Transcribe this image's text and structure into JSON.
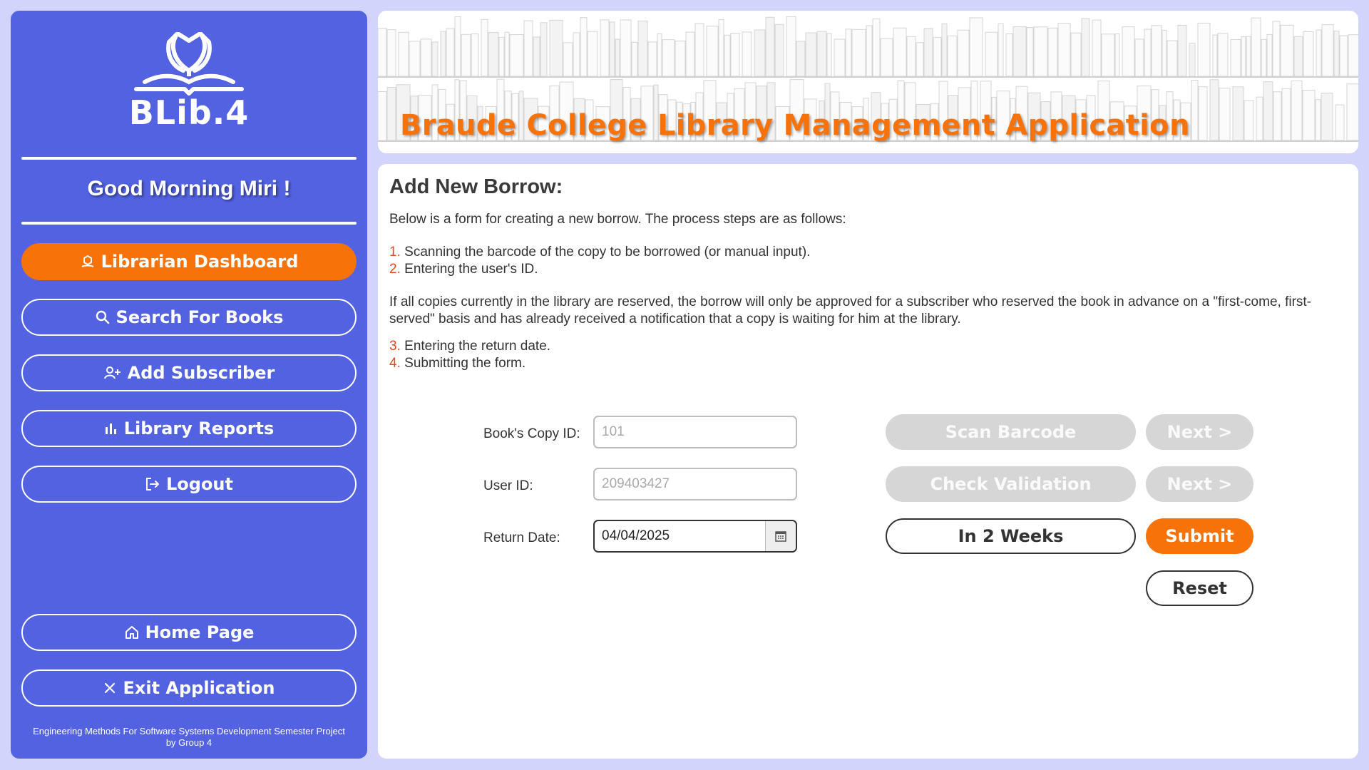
{
  "app": {
    "logo_text": "BLib.4",
    "banner_title": "Braude College Library Management Application"
  },
  "sidebar": {
    "greeting": "Good Morning Miri !",
    "items": [
      {
        "label": "Librarian Dashboard",
        "icon": "dashboard-icon",
        "active": true
      },
      {
        "label": "Search For Books",
        "icon": "search-icon"
      },
      {
        "label": "Add Subscriber",
        "icon": "add-user-icon"
      },
      {
        "label": "Library Reports",
        "icon": "bar-chart-icon"
      },
      {
        "label": "Logout",
        "icon": "logout-icon"
      }
    ],
    "bottom_items": [
      {
        "label": "Home Page",
        "icon": "home-icon"
      },
      {
        "label": "Exit Application",
        "icon": "close-icon"
      }
    ],
    "footer_line1": "Engineering Methods For Software Systems Development Semester Project",
    "footer_line2": "by Group 4"
  },
  "main": {
    "title": "Add New Borrow:",
    "intro": "Below is a form for creating a new borrow. The process steps are as follows:",
    "steps": [
      {
        "num": "1.",
        "text": "Scanning the barcode of the copy to be borrowed (or manual input)."
      },
      {
        "num": "2.",
        "text": "Entering the user's ID."
      },
      {
        "num": "3.",
        "text": "Entering the return date."
      },
      {
        "num": "4.",
        "text": "Submitting the form."
      }
    ],
    "note": "If all copies currently in the library are reserved, the borrow will only be approved for a subscriber who reserved the book in advance on a \"first-come, first-served\" basis and has already received a notification that a copy is waiting for him at the library."
  },
  "form": {
    "copy_id_label": "Book's Copy ID:",
    "copy_id_value": "101",
    "user_id_label": "User ID:",
    "user_id_value": "209403427",
    "return_date_label": "Return Date:",
    "return_date_value": "04/04/2025",
    "scan_barcode_label": "Scan Barcode",
    "check_validation_label": "Check Validation",
    "in_two_weeks_label": "In 2 Weeks",
    "next_label": "Next >",
    "submit_label": "Submit",
    "reset_label": "Reset"
  },
  "colors": {
    "sidebar_bg": "#5262e0",
    "accent_orange": "#f77208",
    "page_bg": "#d2d4fb",
    "disabled_gray": "#d6d6d6",
    "step_number_red": "#e8461f"
  }
}
